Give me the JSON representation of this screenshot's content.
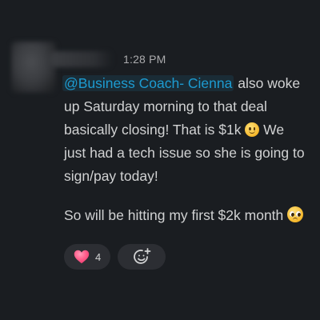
{
  "message": {
    "timestamp": "1:28 PM",
    "mention": "@Business Coach- Cienna",
    "text_1_after_mention": " also woke up Saturday morning to that deal basically closing! That is $1k ",
    "text_1_after_emoji": " We just had a tech issue so she is going to sign/pay today!",
    "text_2": "So will be hitting my first $2k month ",
    "inline_emoji_1": "slightly-smiling-face",
    "inline_emoji_2": "pleading-face"
  },
  "reactions": {
    "heart": {
      "icon": "heart-icon",
      "count": "4",
      "color": "#ff5c8a"
    },
    "add": {
      "icon": "add-emoji-icon"
    }
  },
  "colors": {
    "background": "#1a1d21",
    "mention": "#1d9bd1",
    "text": "#d1d2d3",
    "muted": "#ababad",
    "pill": "#2c2e33"
  }
}
